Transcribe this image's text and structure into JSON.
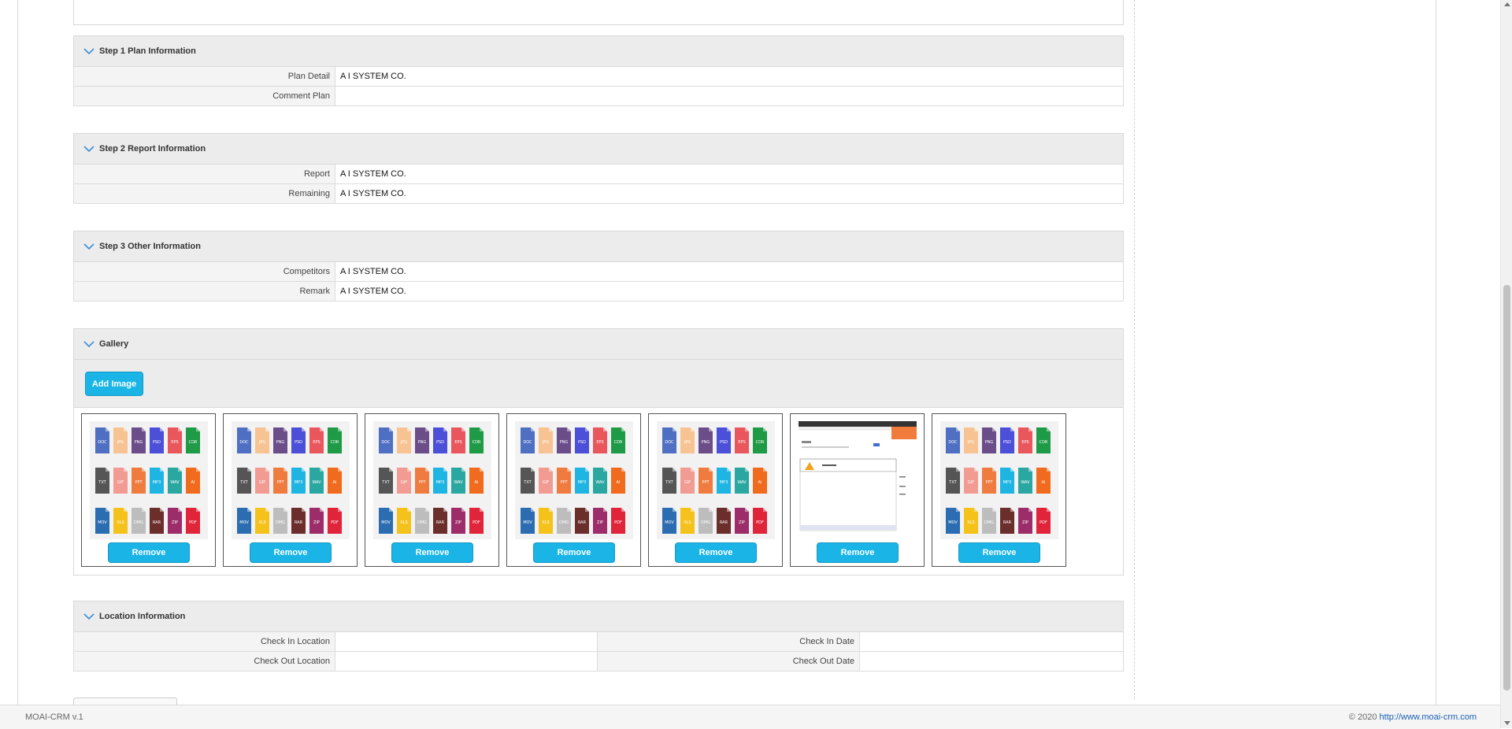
{
  "sections": {
    "step1": {
      "title": "Step 1 Plan Information",
      "rows": [
        {
          "label": "Plan Detail",
          "value": "A I SYSTEM CO."
        },
        {
          "label": "Comment Plan",
          "value": ""
        }
      ]
    },
    "step2": {
      "title": "Step 2 Report Information",
      "rows": [
        {
          "label": "Report",
          "value": "A I SYSTEM CO."
        },
        {
          "label": "Remaining",
          "value": "A I SYSTEM CO."
        }
      ]
    },
    "step3": {
      "title": "Step 3 Other Information",
      "rows": [
        {
          "label": "Competitors",
          "value": "A I SYSTEM CO."
        },
        {
          "label": "Remark",
          "value": "A I SYSTEM CO."
        }
      ]
    },
    "gallery": {
      "title": "Gallery",
      "add_label": "Add Image",
      "remove_label": "Remove",
      "items": [
        {
          "kind": "file-icons"
        },
        {
          "kind": "file-icons"
        },
        {
          "kind": "file-icons"
        },
        {
          "kind": "file-icons"
        },
        {
          "kind": "file-icons"
        },
        {
          "kind": "screenshot"
        },
        {
          "kind": "file-icons"
        }
      ]
    },
    "location": {
      "title": "Location Information",
      "rows": [
        {
          "label": "Check In Location",
          "value": "",
          "label2": "Check In Date",
          "value2": ""
        },
        {
          "label": "Check Out Location",
          "value": "",
          "label2": "Check Out Date",
          "value2": ""
        }
      ]
    }
  },
  "footer": {
    "version": "MOAI-CRM v.1",
    "copyright": "© 2020",
    "link": "http://www.moai-crm.com"
  },
  "file_icon_tiles": [
    [
      "DOC",
      "JPG",
      "PNG",
      "PSD",
      "EPS",
      "CDR"
    ],
    [
      "TXT",
      "GIF",
      "PPT",
      "MP3",
      "WAV",
      "AI"
    ],
    [
      "MOV",
      "XLS",
      "DMG",
      "RAR",
      "ZIP",
      "PDF"
    ]
  ],
  "file_icon_colors": [
    [
      "#4f6fc2",
      "#f7c393",
      "#6b4d8a",
      "#4c4fd8",
      "#e9575d",
      "#1f9b47"
    ],
    [
      "#555555",
      "#f29b93",
      "#ef7b3f",
      "#1fb5e3",
      "#2aa7a0",
      "#f06b1d"
    ],
    [
      "#2b6db0",
      "#f5c21b",
      "#bdbdbd",
      "#6b2e2b",
      "#9c2d6a",
      "#e0243a"
    ]
  ]
}
